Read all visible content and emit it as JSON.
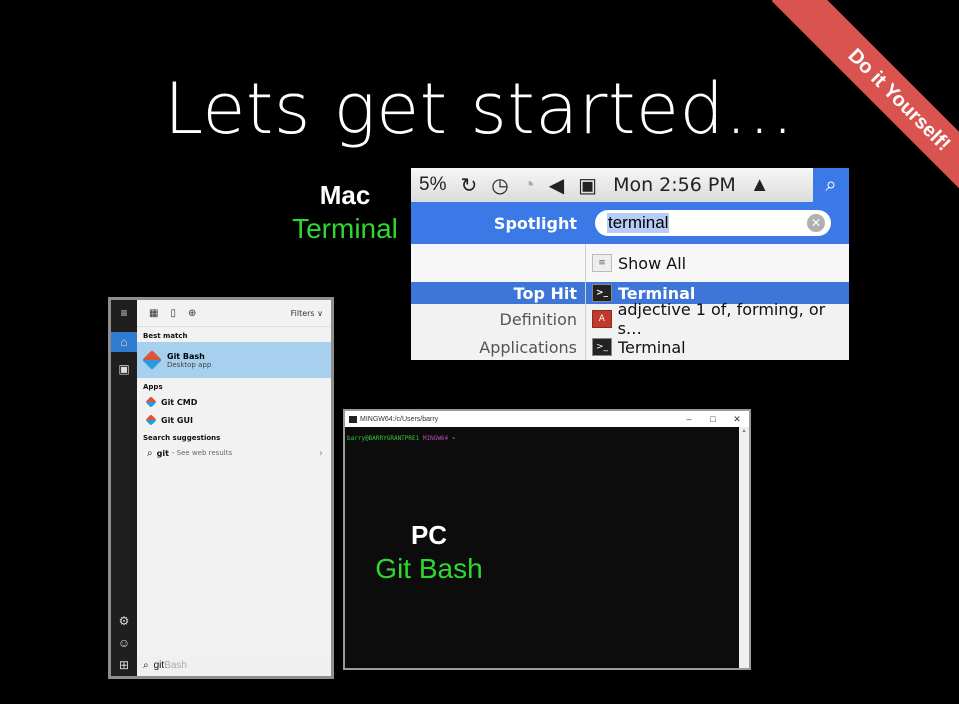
{
  "slide": {
    "title": "Lets get started…",
    "ribbon": "Do it Yourself!",
    "colors": {
      "accent_green": "#2fd82f",
      "ribbon_red": "#d9534f",
      "spotlight_blue": "#3b79e6"
    }
  },
  "mac": {
    "os_label": "Mac",
    "app_label": "Terminal",
    "menubar": {
      "battery": "5%",
      "icons": [
        "sync-icon",
        "time-machine-icon",
        "wifi-icon",
        "volume-icon",
        "activity-icon"
      ],
      "clock": "Mon 2:56 PM",
      "user_icon": "user-icon",
      "search_icon": "search-icon"
    },
    "spotlight": {
      "header_label": "Spotlight",
      "query": "terminal",
      "rows": [
        {
          "label": "",
          "value": "Show All"
        },
        {
          "label": "Top Hit",
          "value": "Terminal"
        },
        {
          "label": "Definition",
          "value": "adjective  1 of, forming, or s…"
        },
        {
          "label": "Applications",
          "value": "Terminal"
        }
      ]
    }
  },
  "windows": {
    "filters": "Filters",
    "best_match_header": "Best match",
    "best_match": {
      "name": "Git Bash",
      "sub": "Desktop app"
    },
    "apps_header": "Apps",
    "apps": [
      "Git CMD",
      "Git GUI"
    ],
    "suggestions_header": "Search suggestions",
    "suggestion": {
      "text": "git",
      "sub": "- See web results"
    },
    "search_text": "git",
    "search_hint": "Bash"
  },
  "terminal": {
    "title": "MINGW64:/c/Users/barry",
    "prompt_user": "barry@BARRYGRANTPRE1",
    "prompt_host": "MINGW64",
    "prompt_path": "~"
  },
  "pc": {
    "os_label": "PC",
    "app_label": "Git Bash"
  }
}
